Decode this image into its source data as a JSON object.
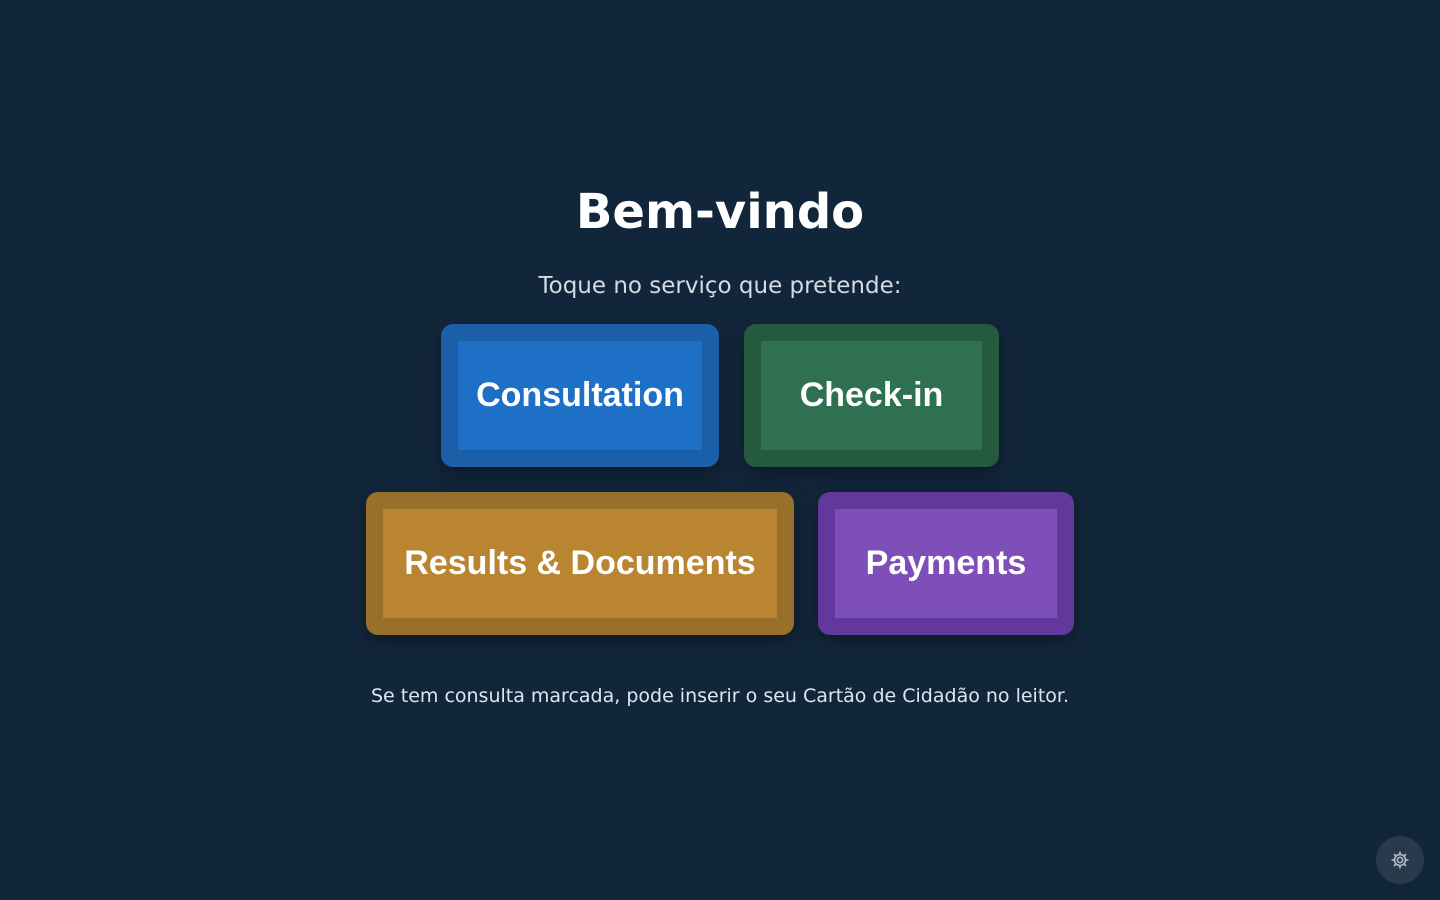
{
  "welcome": {
    "title": "Bem-vindo",
    "subtitle": "Toque no serviço que pretende:"
  },
  "services": [
    {
      "label": "Consultation",
      "color": "#1e70c6"
    },
    {
      "label": "Check-in",
      "color": "#2f7051"
    },
    {
      "label": "Results & Documents",
      "color": "#b98530"
    },
    {
      "label": "Payments",
      "color": "#7e4fb9"
    }
  ],
  "hint": "Se tem consulta marcada, pode inserir o seu Cartão de Cidadão no leitor.",
  "settings": {
    "icon": "gear-icon"
  },
  "colors": {
    "background": "#12263b",
    "text": "#ffffff"
  }
}
